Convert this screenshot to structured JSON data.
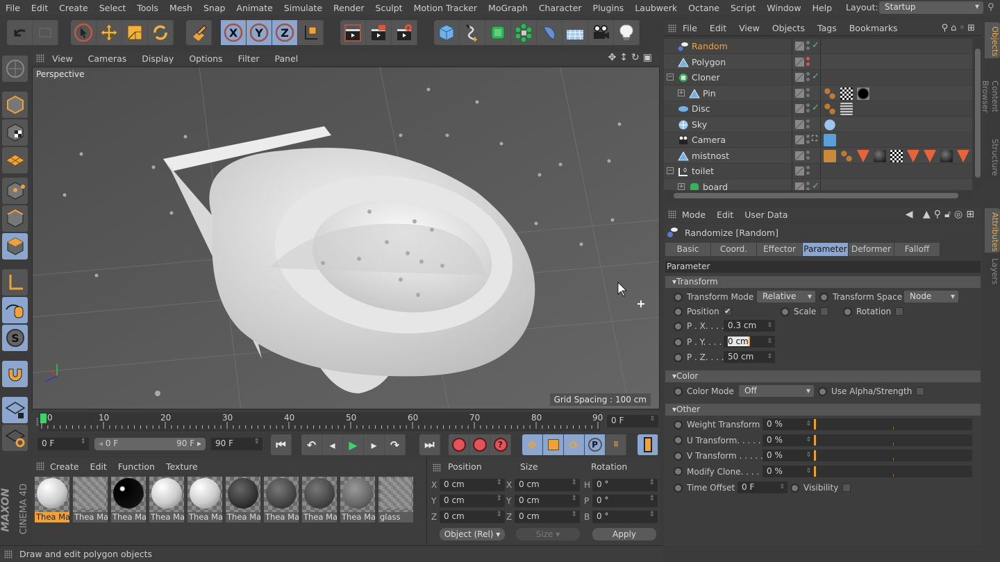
{
  "menubar": {
    "items": [
      "File",
      "Edit",
      "Create",
      "Select",
      "Tools",
      "Mesh",
      "Snap",
      "Animate",
      "Simulate",
      "Render",
      "Sculpt",
      "Motion Tracker",
      "MoGraph",
      "Character",
      "Plugins",
      "Laubwerk",
      "Octane",
      "Script",
      "Window",
      "Help"
    ],
    "layout_label": "Layout:",
    "layout_value": "Startup"
  },
  "toolbar": {
    "groups": [
      [
        "undo-icon",
        "redo-icon"
      ],
      [
        "live-selection-icon",
        "move-icon",
        "scale-icon",
        "rotate-icon"
      ],
      [
        "recent-tools-icon"
      ],
      [
        "x-axis-icon",
        "y-axis-icon",
        "z-axis-icon",
        "world-coordinates-icon"
      ],
      [
        "render-view-icon",
        "render-region-icon",
        "render-settings-icon"
      ],
      [
        "cube-icon",
        "spline-pen-icon",
        "subdivision-icon",
        "cloner-icon",
        "deformer-icon",
        "floor-icon",
        "camera-icon",
        "light-icon"
      ]
    ]
  },
  "viewport": {
    "menu": [
      "View",
      "Cameras",
      "Display",
      "Options",
      "Filter",
      "Panel"
    ],
    "label": "Perspective",
    "grid_spacing": "Grid Spacing : 100 cm"
  },
  "timeline": {
    "ticks": [
      "0",
      "10",
      "20",
      "30",
      "40",
      "50",
      "60",
      "70",
      "80",
      "90"
    ],
    "current_frame": "0 F",
    "start_frame": "0 F",
    "range_start": "0 F",
    "range_end": "90 F",
    "end_frame": "90 F"
  },
  "materials": {
    "menu": [
      "Create",
      "Edit",
      "Function",
      "Texture"
    ],
    "items": [
      {
        "label": "Thea Ma",
        "selected": true,
        "style": "white"
      },
      {
        "label": "Thea Ma",
        "selected": false,
        "style": "checker"
      },
      {
        "label": "Thea Ma",
        "selected": false,
        "style": "black-gloss"
      },
      {
        "label": "Thea Ma",
        "selected": false,
        "style": "white"
      },
      {
        "label": "Thea Ma",
        "selected": false,
        "style": "white"
      },
      {
        "label": "Thea Ma",
        "selected": false,
        "style": "dark"
      },
      {
        "label": "Thea Ma",
        "selected": false,
        "style": "dark-grey"
      },
      {
        "label": "Thea Ma",
        "selected": false,
        "style": "dark-tile"
      },
      {
        "label": "Thea Ma",
        "selected": false,
        "style": "grey"
      },
      {
        "label": "glass",
        "selected": false,
        "style": "checker"
      }
    ]
  },
  "coords": {
    "headers": [
      "Position",
      "Size",
      "Rotation"
    ],
    "position": [
      {
        "axis": "X",
        "value": "0 cm"
      },
      {
        "axis": "Y",
        "value": "0 cm"
      },
      {
        "axis": "Z",
        "value": "0 cm"
      }
    ],
    "size": [
      {
        "axis": "X",
        "value": "0 cm"
      },
      {
        "axis": "Y",
        "value": "0 cm"
      },
      {
        "axis": "Z",
        "value": "0 cm"
      }
    ],
    "rotation": [
      {
        "axis": "H",
        "value": "0 °"
      },
      {
        "axis": "P",
        "value": "0 °"
      },
      {
        "axis": "B",
        "value": "0 °"
      }
    ],
    "mode": "Object (Rel)",
    "size_mode": "Size",
    "apply": "Apply"
  },
  "status": "Draw and edit polygon objects",
  "logo": {
    "brand": "MAXON",
    "product": "CINEMA 4D"
  },
  "objects": {
    "menu": [
      "File",
      "Edit",
      "View",
      "Objects",
      "Tags",
      "Bookmarks"
    ],
    "rows": [
      {
        "name": "Random",
        "active": true,
        "icon": "effector",
        "check": "green"
      },
      {
        "name": "Polygon",
        "active": false,
        "icon": "polygon",
        "check": "red"
      },
      {
        "name": "Cloner",
        "active": false,
        "icon": "cloner",
        "check": "green",
        "expand": "minus"
      },
      {
        "name": "Pin",
        "active": false,
        "icon": "polygon",
        "check": "none",
        "expand": "plus",
        "tags": [
          "phong",
          "material-checker",
          "material-black"
        ]
      },
      {
        "name": "Disc",
        "active": false,
        "icon": "disc",
        "check": "green",
        "tags": [
          "phong",
          "material-tile"
        ]
      },
      {
        "name": "Sky",
        "active": false,
        "icon": "sky",
        "check": "none",
        "tags": [
          "sky-tag"
        ]
      },
      {
        "name": "Camera",
        "active": false,
        "icon": "camera",
        "check": "target",
        "tags": [
          "camera-tag"
        ]
      },
      {
        "name": "mistnost",
        "active": false,
        "icon": "polygon",
        "check": "none",
        "tags": [
          "visibility",
          "phong",
          "selection",
          "material-dark",
          "material-checker",
          "selection",
          "selection",
          "material-dark",
          "selection",
          "material-dark"
        ]
      },
      {
        "name": "toilet",
        "active": false,
        "icon": "null",
        "check": "none",
        "expand": "minus"
      },
      {
        "name": "board",
        "active": false,
        "icon": "subdivision",
        "check": "green",
        "expand": "plus"
      }
    ],
    "side_tabs": [
      "Objects",
      "Content Browser",
      "Structure"
    ]
  },
  "attributes": {
    "menu": [
      "Mode",
      "Edit",
      "User Data"
    ],
    "title": "Randomize [Random]",
    "tabs": [
      "Basic",
      "Coord.",
      "Effector",
      "Parameter",
      "Deformer",
      "Falloff"
    ],
    "active_tab": "Parameter",
    "section": "Parameter",
    "transform": {
      "header": "Transform",
      "mode_label": "Transform Mode",
      "mode_value": "Relative",
      "space_label": "Transform Space",
      "space_value": "Node",
      "position_label": "Position",
      "position_checked": true,
      "scale_label": "Scale",
      "rotation_label": "Rotation",
      "px_label": "P . X. . . .",
      "px": "0.3 cm",
      "py_label": "P . Y. . . .",
      "py": "0 cm",
      "pz_label": "P . Z. . . .",
      "pz": "50 cm"
    },
    "color": {
      "header": "Color",
      "mode_label": "Color Mode",
      "mode_value": "Off",
      "alpha_label": "Use Alpha/Strength"
    },
    "other": {
      "header": "Other",
      "rows": [
        {
          "label": "Weight Transform",
          "value": "0 %",
          "fraction": 0
        },
        {
          "label": "U Transform. . . . .",
          "value": "0 %",
          "fraction": 0
        },
        {
          "label": "V Transform . . . . .",
          "value": "0 %",
          "fraction": 0
        },
        {
          "label": "Modify Clone. . . .",
          "value": "0 %",
          "fraction": 0
        }
      ],
      "time_offset_label": "Time Offset",
      "time_offset": "0 F",
      "visibility_label": "Visibility"
    },
    "side_tabs": [
      "Attributes",
      "Layers"
    ]
  },
  "colors": {
    "accent_orange": "#e9a843",
    "selection_blue": "#8ba6cf",
    "panel": "#3d3d3d"
  }
}
